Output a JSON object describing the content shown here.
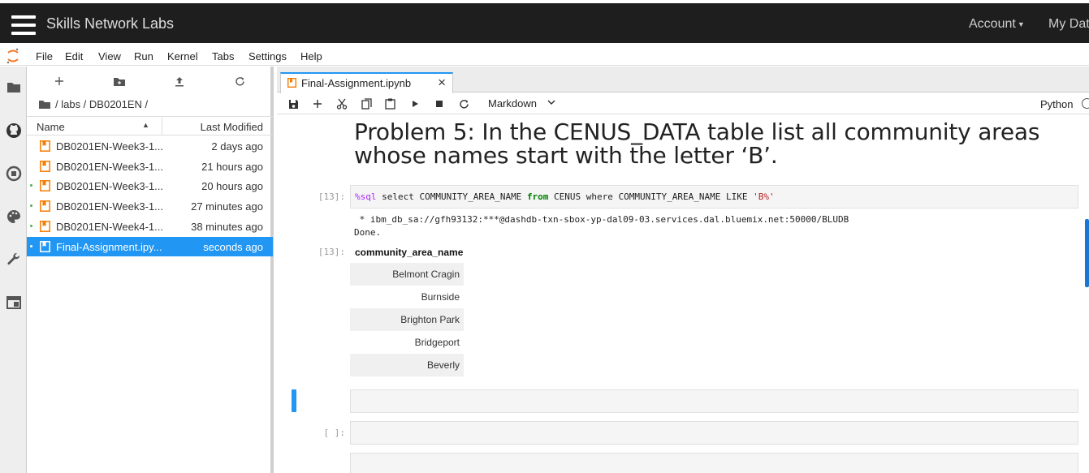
{
  "topbar": {
    "brand": "Skills Network Labs",
    "account_label": "Account",
    "mydata_label": "My Dat"
  },
  "menu": [
    "File",
    "Edit",
    "View",
    "Run",
    "Kernel",
    "Tabs",
    "Settings",
    "Help"
  ],
  "filebrowser": {
    "breadcrumb": "/ labs / DB0201EN /",
    "col_name": "Name",
    "col_modified": "Last Modified",
    "files": [
      {
        "name": "DB0201EN-Week3-1...",
        "modified": "2 days ago",
        "running": false,
        "selected": false
      },
      {
        "name": "DB0201EN-Week3-1...",
        "modified": "21 hours ago",
        "running": false,
        "selected": false
      },
      {
        "name": "DB0201EN-Week3-1...",
        "modified": "20 hours ago",
        "running": true,
        "selected": false
      },
      {
        "name": "DB0201EN-Week3-1...",
        "modified": "27 minutes ago",
        "running": true,
        "selected": false
      },
      {
        "name": "DB0201EN-Week4-1...",
        "modified": "38 minutes ago",
        "running": true,
        "selected": false
      },
      {
        "name": "Final-Assignment.ipy...",
        "modified": "seconds ago",
        "running": true,
        "selected": true
      }
    ]
  },
  "tab": {
    "title": "Final-Assignment.ipynb",
    "close": "×"
  },
  "toolbar": {
    "cell_type": "Markdown",
    "kernel": "Python"
  },
  "notebook": {
    "heading": "Problem 5: In the CENUS_DATA table list all community areas whose names start with the letter ‘B’.",
    "cell13": {
      "prompt_in": "[13]:",
      "magic": "%sql",
      "code_a": " select COMMUNITY_AREA_NAME ",
      "kw_from": "from",
      "code_b": " CENUS where COMMUNITY_AREA_NAME LIKE ",
      "str": "'B%'",
      "stdout_line1": " * ibm_db_sa://gfh93132:***@dashdb-txn-sbox-yp-dal09-03.services.dal.bluemix.net:50000/BLUDB",
      "stdout_line2": "Done.",
      "prompt_out": "[13]:",
      "table_header": "community_area_name",
      "rows": [
        "Belmont Cragin",
        "Burnside",
        "Brighton Park",
        "Bridgeport",
        "Beverly"
      ]
    },
    "empty_prompt": "[ ]:"
  },
  "icons": {
    "activity": [
      "folder-icon",
      "github-icon",
      "stop-circle-icon",
      "palette-icon",
      "wrench-icon",
      "tabs-icon"
    ]
  },
  "colors": {
    "accent": "#2196f3",
    "topbar": "#1e1e1e",
    "notebook_icon": "#f57c00"
  }
}
